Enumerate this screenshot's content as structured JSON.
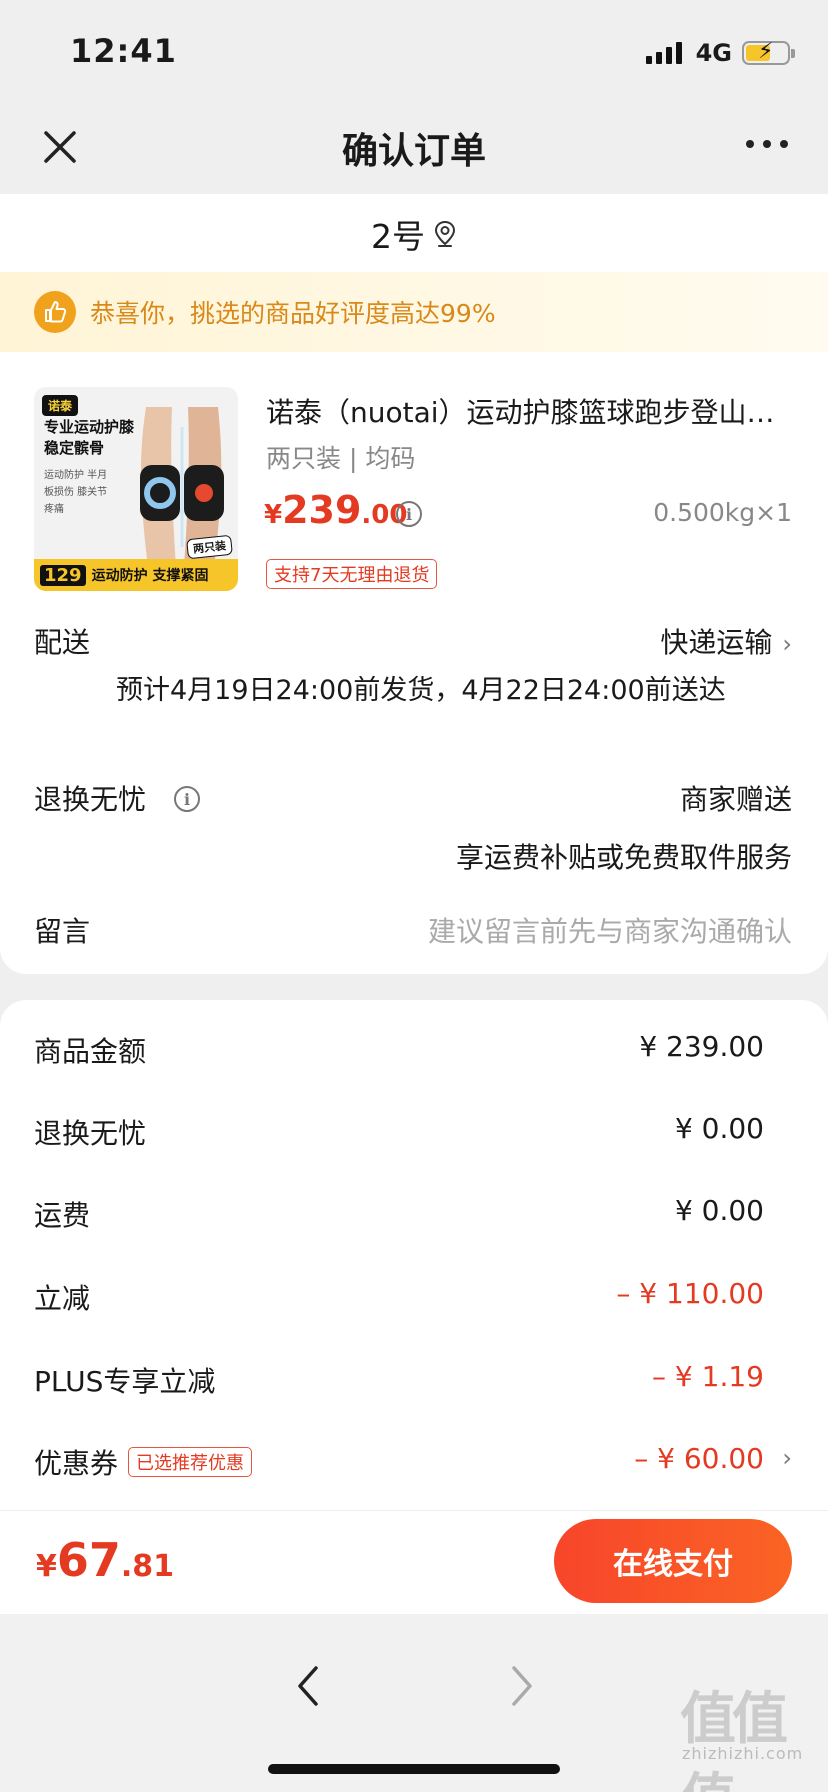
{
  "status": {
    "time": "12:41",
    "network": "4G"
  },
  "nav": {
    "title": "确认订单"
  },
  "address": {
    "label": "2号"
  },
  "praise": {
    "text": "恭喜你，挑选的商品好评度高达99%"
  },
  "product": {
    "image": {
      "brand": "诺泰",
      "headline": "专业运动护膝 稳定髌骨",
      "features": "运动防护 半月板损伤 膝关节疼痛",
      "badge": "两只装",
      "price_tag": "129",
      "slogan": "运动防护 支撑紧固"
    },
    "title": "诺泰（nuotai）运动护膝篮球跑步登山骑行护膝",
    "spec": "两只装 | 均码",
    "price_currency": "¥",
    "price_int": "239",
    "price_dec": ".00",
    "qty": "0.500kg×1",
    "return_tag": "支持7天无理由退货"
  },
  "shipping": {
    "label": "配送",
    "method": "快递运输",
    "estimate": "预计4月19日24:00前发货，4月22日24:00前送达"
  },
  "returns": {
    "label": "退换无忧",
    "value": "商家赠送",
    "subtext": "享运费补贴或免费取件服务"
  },
  "message": {
    "label": "留言",
    "placeholder": "建议留言前先与商家沟通确认"
  },
  "summary": {
    "rows": [
      {
        "label": "商品金额",
        "value": "¥ 239.00"
      },
      {
        "label": "退换无忧",
        "value": "¥ 0.00"
      },
      {
        "label": "运费",
        "value": "¥ 0.00"
      },
      {
        "label": "立减",
        "value": "– ¥ 110.00"
      },
      {
        "label": "PLUS专享立减",
        "value": "– ¥ 1.19"
      },
      {
        "label": "优惠券",
        "tag": "已选推荐优惠",
        "value": "– ¥ 60.00"
      }
    ]
  },
  "paybar": {
    "total_currency": "¥",
    "total_int": "67",
    "total_dec": ".81",
    "pay_label": "在线支付"
  },
  "watermark": {
    "glyph": "值值值",
    "text": "zhizhizhi.com"
  },
  "colors": {
    "accent": "#e53a22",
    "praise": "#d9891a",
    "pay_gradient_start": "#f8452b",
    "pay_gradient_end": "#fa6424"
  }
}
